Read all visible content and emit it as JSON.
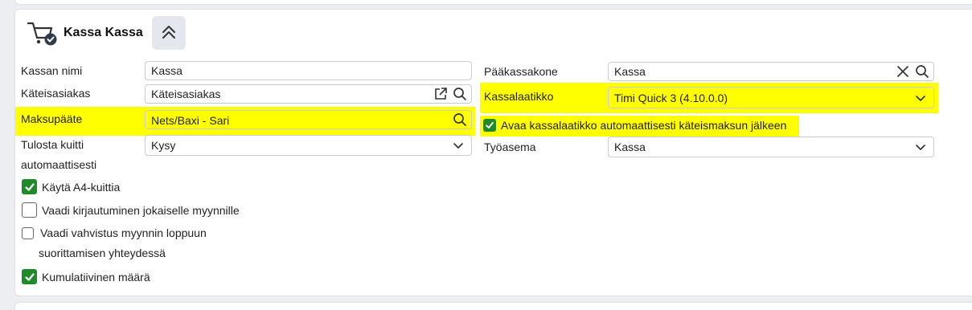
{
  "section": {
    "title": "Kassa Kassa",
    "cart_icon": "cart-check-icon",
    "collapse_icon": "chevron-double-up-icon"
  },
  "left": {
    "kassan_nimi": {
      "label": "Kassan nimi",
      "value": "Kassa"
    },
    "kateisasiakas": {
      "label": "Käteisasiakas",
      "value": "Käteisasiakas"
    },
    "maksupaate": {
      "label": "Maksupääte",
      "value": "Nets/Baxi - Sari"
    },
    "tulosta_kuitti": {
      "label_line1": "Tulosta kuitti",
      "label_line2": "automaattisesti",
      "value": "Kysy"
    },
    "checkboxes": [
      {
        "label": "Käytä A4-kuittia",
        "checked": true
      },
      {
        "label": "Vaadi kirjautuminen jokaiselle myynnille",
        "checked": false
      },
      {
        "label_line1": "Vaadi vahvistus myynnin loppuun",
        "label_line2": "suorittamisen yhteydessä",
        "checked": false
      },
      {
        "label": "Kumulatiivinen määrä",
        "checked": true
      }
    ]
  },
  "right": {
    "paakassakone": {
      "label": "Pääkassakone",
      "value": "Kassa"
    },
    "kassalaatikko": {
      "label": "Kassalaatikko",
      "value": "Timi Quick 3 (4.10.0.0)"
    },
    "avaa_checkbox": {
      "label": "Avaa kassalaatikko automaattisesti käteismaksun jälkeen",
      "checked": true
    },
    "tyoasema": {
      "label": "Työasema",
      "value": "Kassa"
    }
  },
  "colors": {
    "highlight": "#ffff00",
    "check_green": "#1f8a29",
    "border": "#c8ccd2"
  }
}
